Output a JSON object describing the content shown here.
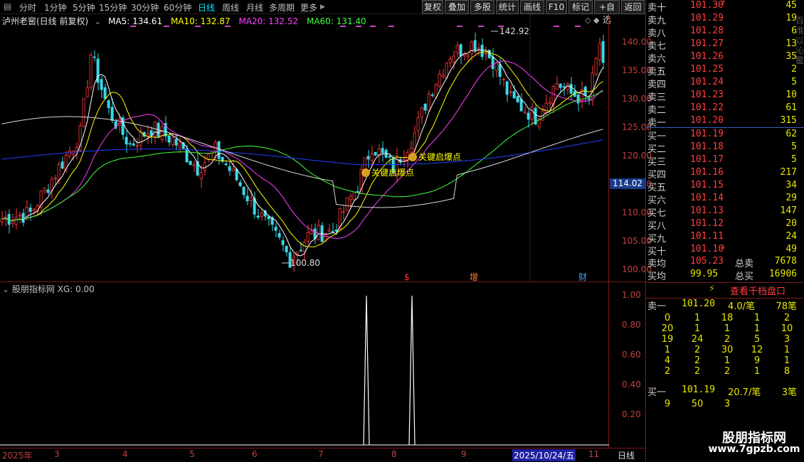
{
  "toolbar": {
    "periods": [
      "分时",
      "1分钟",
      "5分钟",
      "15分钟",
      "30分钟",
      "60分钟",
      "日线",
      "周线",
      "月线",
      "多周期",
      "更多"
    ],
    "active_period": "日线",
    "right_buttons": [
      "复权",
      "叠加",
      "多股",
      "统计",
      "画线",
      "F10",
      "标记",
      "+自选",
      "返回"
    ]
  },
  "stock": {
    "name": "泸州老窖(日线 前复权)"
  },
  "ma_legend": [
    {
      "label": "MA5: 134.61",
      "color": "#ffffff"
    },
    {
      "label": "MA10: 132.87",
      "color": "#ffff00"
    },
    {
      "label": "MA20: 132.52",
      "color": "#ff00ff"
    },
    {
      "label": "MA60: 131.40",
      "color": "#00ff00"
    }
  ],
  "price_axis": [
    "140.00",
    "135.00",
    "130.00",
    "125.00",
    "120.00",
    "115.00",
    "110.00",
    "105.00",
    "100.00"
  ],
  "current_price_tag": "114.02",
  "annotations": {
    "high": "142.92",
    "low": "100.80",
    "signal1": "关键启爆点",
    "signal2": "关键启爆点",
    "marker_s": "$",
    "marker_zeng": "增",
    "marker_cai": "财"
  },
  "indicator": {
    "title": "股朋指标网 XG: 0.00",
    "axis": [
      "1.00",
      "0.80",
      "0.60",
      "0.40",
      "0.20"
    ]
  },
  "date_axis": {
    "labels": [
      "2025年",
      "3",
      "4",
      "5",
      "6",
      "7",
      "8",
      "9",
      "11"
    ],
    "cursor_date": "2025/10/24/五",
    "period_label": "日线"
  },
  "order_book": {
    "asks": [
      {
        "label": "卖十",
        "price": "101.30",
        "vol": "45",
        "arrow": "↑"
      },
      {
        "label": "卖九",
        "price": "101.29",
        "vol": "19"
      },
      {
        "label": "卖八",
        "price": "101.28",
        "vol": "6"
      },
      {
        "label": "卖七",
        "price": "101.27",
        "vol": "13"
      },
      {
        "label": "卖六",
        "price": "101.26",
        "vol": "35"
      },
      {
        "label": "卖五",
        "price": "101.25",
        "vol": "2"
      },
      {
        "label": "卖四",
        "price": "101.24",
        "vol": "5"
      },
      {
        "label": "卖三",
        "price": "101.23",
        "vol": "10"
      },
      {
        "label": "卖二",
        "price": "101.22",
        "vol": "61"
      },
      {
        "label": "卖一",
        "price": "101.20",
        "vol": "315"
      }
    ],
    "bids": [
      {
        "label": "买一",
        "price": "101.19",
        "vol": "62"
      },
      {
        "label": "买二",
        "price": "101.18",
        "vol": "5"
      },
      {
        "label": "买三",
        "price": "101.17",
        "vol": "5"
      },
      {
        "label": "买四",
        "price": "101.16",
        "vol": "217"
      },
      {
        "label": "买五",
        "price": "101.15",
        "vol": "34"
      },
      {
        "label": "买六",
        "price": "101.14",
        "vol": "29"
      },
      {
        "label": "买七",
        "price": "101.13",
        "vol": "147"
      },
      {
        "label": "买八",
        "price": "101.12",
        "vol": "20"
      },
      {
        "label": "买九",
        "price": "101.11",
        "vol": "24"
      },
      {
        "label": "买十",
        "price": "101.10",
        "vol": "49",
        "arrow": "↓"
      }
    ],
    "summary": [
      {
        "label": "卖均",
        "price": "105.23",
        "tlabel": "总卖",
        "total": "7678"
      },
      {
        "label": "买均",
        "price": "99.95",
        "tlabel": "总买",
        "total": "16906"
      }
    ],
    "view_full_button": "查看千档盘口",
    "ask1_queue": {
      "label": "卖一",
      "price": "101.20",
      "per": "4.0/笔",
      "count": "78笔",
      "rows": [
        [
          "0",
          "1",
          "18",
          "1",
          "2"
        ],
        [
          "20",
          "1",
          "1",
          "1",
          "10"
        ],
        [
          "19",
          "24",
          "2",
          "5",
          "3"
        ],
        [
          "1",
          "2",
          "30",
          "12",
          "1"
        ],
        [
          "4",
          "2",
          "1",
          "9",
          "1"
        ],
        [
          "2",
          "2",
          "2",
          "1",
          "8"
        ]
      ]
    },
    "bid1_queue": {
      "label": "买一",
      "price": "101.19",
      "per": "20.7/笔",
      "count": "3笔",
      "rows": [
        [
          "9",
          "50",
          "3"
        ]
      ]
    }
  },
  "watermark": {
    "line1": "股朋指标网",
    "line2": "www.7gpzb.com"
  },
  "side_strip": "百\n淮\n以\n沁\n鳖"
}
